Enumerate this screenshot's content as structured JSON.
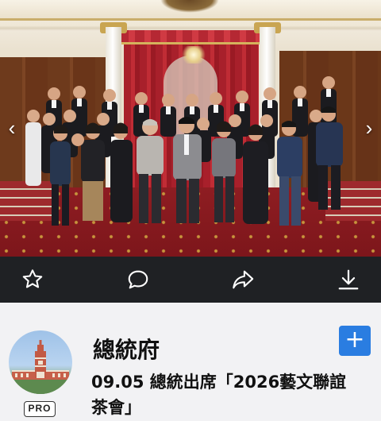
{
  "photo": {
    "alt_icon": "group-photo",
    "prev_icon": "chevron-left-icon",
    "next_icon": "chevron-right-icon",
    "prev_glyph": "‹",
    "next_glyph": "›"
  },
  "actions": [
    {
      "name": "favorite-button",
      "icon": "star-icon"
    },
    {
      "name": "comment-button",
      "icon": "comment-icon"
    },
    {
      "name": "share-button",
      "icon": "share-icon"
    },
    {
      "name": "download-button",
      "icon": "download-icon"
    }
  ],
  "account": {
    "name": "總統府",
    "badge": "PRO",
    "follow_label": "+"
  },
  "post": {
    "title": "09.05 總統出席「2026藝文聯誼茶會」"
  },
  "colors": {
    "action_bar_bg": "#1f2124",
    "follow_button": "#2a7de1",
    "page_bg": "#f2f2f4"
  }
}
